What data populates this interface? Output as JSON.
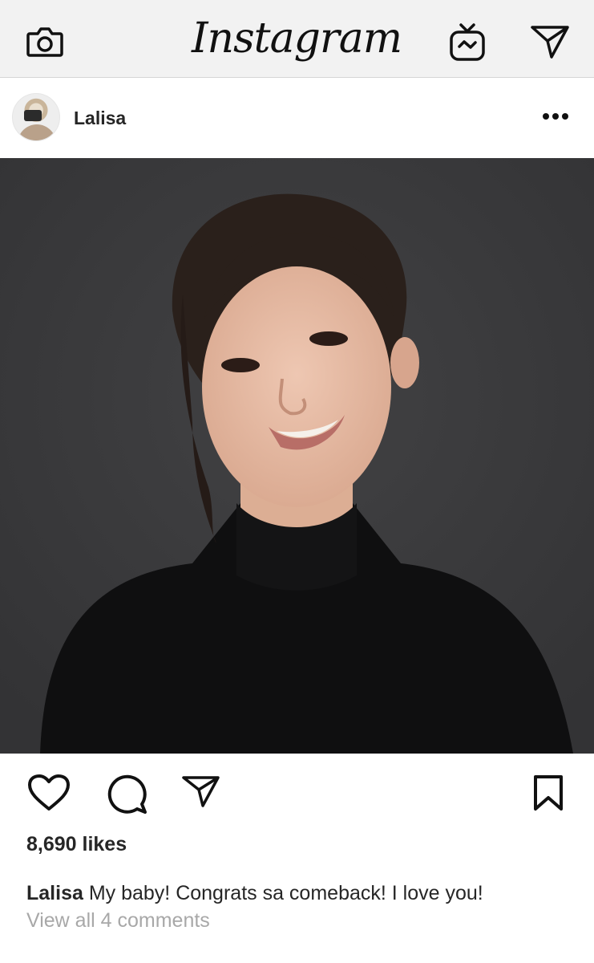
{
  "header": {
    "logo_text": "Instagram",
    "icons": [
      "camera-icon",
      "igtv-icon",
      "direct-message-icon"
    ]
  },
  "post": {
    "username": "Lalisa",
    "more_icon": "more-options-icon",
    "photo_description_icon": "post-photo",
    "actions": [
      "heart-icon",
      "comment-icon",
      "share-icon",
      "bookmark-icon"
    ],
    "likes": "8,690 likes",
    "caption_user": "Lalisa",
    "caption_text": " My baby! Congrats sa comeback! I love you!",
    "view_comments": "View all 4 comments"
  },
  "colors": {
    "topbar_bg": "#f2f2f2",
    "text": "#262626",
    "muted": "#a8a8a8",
    "photo_bg": "#3a3a3c"
  }
}
